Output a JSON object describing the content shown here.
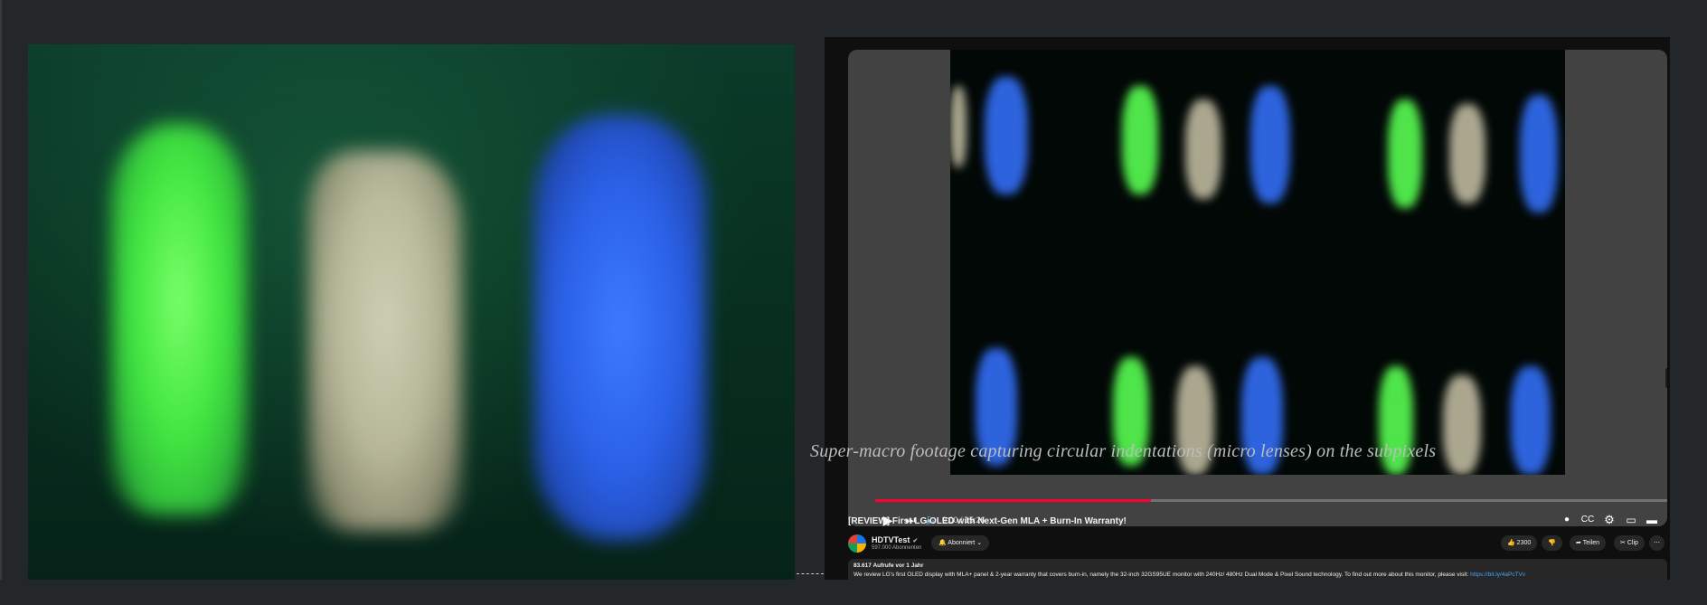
{
  "caption": {
    "text": "Super-macro footage capturing circular indentations (micro lenses) on the subpixels"
  },
  "video": {
    "time": "0:00 / 15:26",
    "progress": 0.34,
    "title": "[REVIEW] First LG OLED with Next-Gen MLA + Burn-In Warranty!"
  },
  "channel": {
    "name": "HDTVTest",
    "subscribers": "597.000 Abonnenten",
    "subscribe_label": "Abonniert"
  },
  "actions": {
    "likes": "2300",
    "share_label": "Teilen",
    "clip_label": "Clip"
  },
  "description": {
    "meta": "83.617 Aufrufe  vor 1 Jahr",
    "text": "We review LG's first OLED display with MLA+ panel & 2-year warranty that covers burn-in, namely the 32-inch 32GS95UE monitor with 240Hz/ 480Hz Dual Mode & Pixel Sound technology. To find out more about this monitor, please visit: ",
    "link": "https://bit.ly/4aPcTVv"
  },
  "icons": {
    "play": "play-icon",
    "next": "skip-next-icon",
    "volume": "volume-icon",
    "subtitles": "subtitles-icon",
    "settings": "gear-icon",
    "miniplayer": "miniplayer-icon",
    "theater": "theater-mode-icon",
    "fullscreen": "fullscreen-icon",
    "bell": "bell-icon",
    "like": "thumbs-up-icon",
    "dislike": "thumbs-down-icon",
    "share": "share-icon",
    "clip": "scissors-icon",
    "more": "more-icon"
  },
  "colors": {
    "accent": "#ff0033",
    "link": "#3ea6ff",
    "panel_bg": "#0f0f0f"
  }
}
